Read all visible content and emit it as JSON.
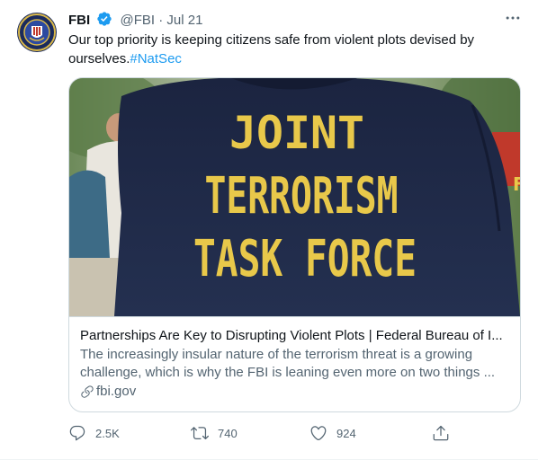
{
  "tweet": {
    "author_name": "FBI",
    "handle": "@FBI",
    "separator": "·",
    "time": "Jul 21",
    "text": "Our top priority is keeping citizens safe from violent plots devised by ourselves.",
    "hashtag": "#NatSec",
    "verified": true
  },
  "card": {
    "image_text_line1": "JOINT",
    "image_text_line2": "TERRORISM",
    "image_text_line3": "TASK FORCE",
    "title": "Partnerships Are Key to Disrupting Violent Plots | Federal Bureau of I...",
    "description_line1": "The increasingly insular nature of the terrorism threat is a growing",
    "description_line2": "challenge, which is why the FBI is leaning even more on two things ...",
    "domain": "fbi.gov"
  },
  "actions": {
    "reply_count": "2.5K",
    "retweet_count": "740",
    "like_count": "924"
  },
  "colors": {
    "accent": "#1d9bf0",
    "muted": "#536471",
    "border": "#cfd9de",
    "jacket": "#1f2a44",
    "lettering": "#e8c84a"
  },
  "icons": [
    "fbi-seal-avatar",
    "verified-badge-icon",
    "more-icon",
    "link-icon",
    "reply-icon",
    "retweet-icon",
    "like-icon",
    "share-icon"
  ]
}
